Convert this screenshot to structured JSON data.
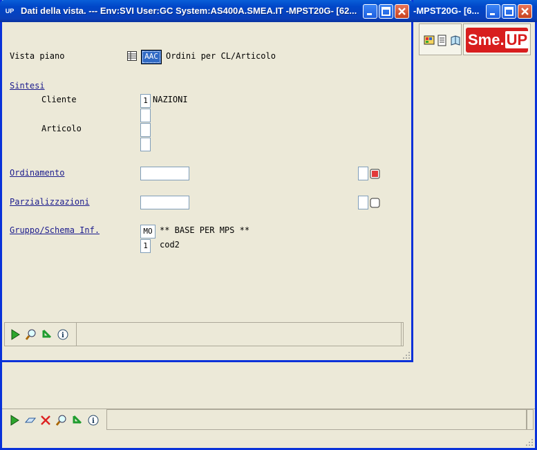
{
  "background_window": {
    "title": "-MPST20G- [6...",
    "logo": {
      "text": "Sme.",
      "up": "UP"
    },
    "toolbox_icons": [
      "color-palette-icon",
      "document-list-icon",
      "book-icon"
    ],
    "bottom_toolbar_icons": [
      "play-icon",
      "eraser-icon",
      "delete-x-icon",
      "search-icon",
      "back-arrow-icon",
      "info-icon"
    ]
  },
  "dialog": {
    "app_icon": "UP",
    "title": "Dati della vista. --- Env:SVI User:GC System:AS400A.SMEA.IT -MPST20G- [62...",
    "vista_piano": {
      "label": "Vista piano",
      "code": "AAC",
      "description": "Ordini per CL/Articolo"
    },
    "sintesi": {
      "link": "Sintesi",
      "cliente_label": "Cliente",
      "cliente_code": "1",
      "cliente_value": "NAZIONI",
      "articolo_label": "Articolo"
    },
    "ordinamento": {
      "link": "Ordinamento",
      "value": ""
    },
    "parzializzazioni": {
      "link": "Parzializzazioni",
      "value": ""
    },
    "gruppo": {
      "link": "Gruppo/Schema Inf.",
      "code1": "MO",
      "desc1": "** BASE PER MPS **",
      "code2": "1",
      "desc2": "cod2"
    },
    "footer_icons": [
      "play-icon",
      "search-icon",
      "back-arrow-icon",
      "info-icon"
    ],
    "colors": {
      "title_blue": "#0046c8",
      "frame": "#0831d9",
      "link": "#1a1a8c",
      "face": "#ece9d8"
    }
  }
}
